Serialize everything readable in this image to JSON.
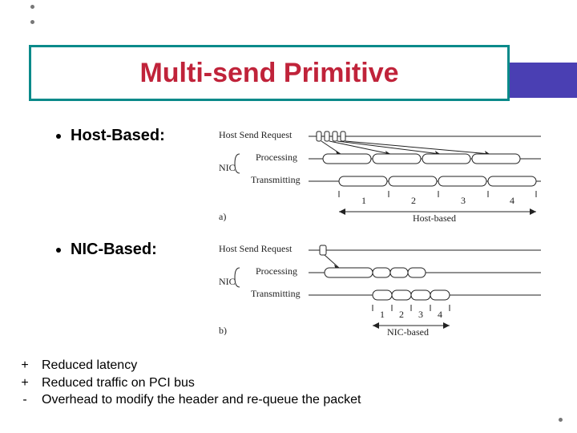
{
  "title": "Multi-send Primitive",
  "sections": {
    "host": {
      "label": "Host-Based:"
    },
    "nic": {
      "label": "NIC-Based:"
    }
  },
  "diagram_labels": {
    "host_send_request": "Host Send Request",
    "processing": "Processing",
    "nic_brace": "NIC",
    "transmitting": "Transmitting",
    "numbers": [
      "1",
      "2",
      "3",
      "4"
    ]
  },
  "diagram_captions": {
    "a": {
      "tag": "a)",
      "text": "Host-based"
    },
    "b": {
      "tag": "b)",
      "text": "NIC-based"
    }
  },
  "notes": [
    {
      "sign": "+",
      "text": "Reduced latency"
    },
    {
      "sign": "+",
      "text": "Reduced traffic on PCI bus"
    },
    {
      "sign": "-",
      "text": "Overhead to modify the header and re-queue the packet"
    }
  ],
  "chart_data": [
    {
      "type": "table",
      "title": "Host-based multi-send timing",
      "rows": [
        {
          "lane": "Host Send Request",
          "events": [
            1,
            2,
            3,
            4
          ],
          "note": "4 short separate requests near start"
        },
        {
          "lane": "Processing",
          "events": [
            1,
            2,
            3,
            4
          ],
          "note": "4 long sequential blocks"
        },
        {
          "lane": "Transmitting",
          "events": [
            1,
            2,
            3,
            4
          ],
          "note": "4 long sequential blocks, offset after processing"
        }
      ],
      "caption": "a) Host-based"
    },
    {
      "type": "table",
      "title": "NIC-based multi-send timing",
      "rows": [
        {
          "lane": "Host Send Request",
          "events": [
            1
          ],
          "note": "single short request"
        },
        {
          "lane": "Processing",
          "events": [
            1,
            2,
            3,
            4
          ],
          "note": "1 long block then 3 short back-to-back blocks"
        },
        {
          "lane": "Transmitting",
          "events": [
            1,
            2,
            3,
            4
          ],
          "note": "4 short adjacent blocks"
        }
      ],
      "caption": "b) NIC-based"
    }
  ]
}
